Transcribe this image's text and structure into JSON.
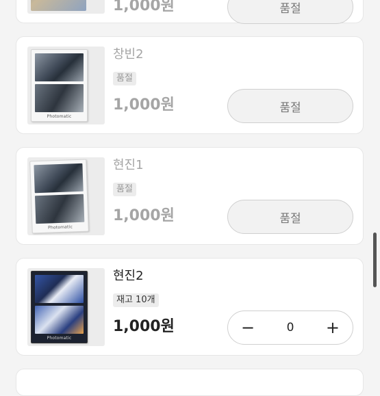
{
  "top_card": {
    "price": "1,000원",
    "button_label": "품절"
  },
  "items": [
    {
      "name": "창빈2",
      "badge": "품절",
      "price": "1,000원",
      "button_label": "품절",
      "thumb_brand": "Photomatic"
    },
    {
      "name": "현진1",
      "badge": "품절",
      "price": "1,000원",
      "button_label": "품절",
      "thumb_brand": "Photomatic"
    },
    {
      "name": "현진2",
      "badge": "재고 10개",
      "price": "1,000원",
      "quantity": "0",
      "thumb_brand": "Photomatic",
      "minus_symbol": "−",
      "plus_symbol": "+"
    }
  ]
}
